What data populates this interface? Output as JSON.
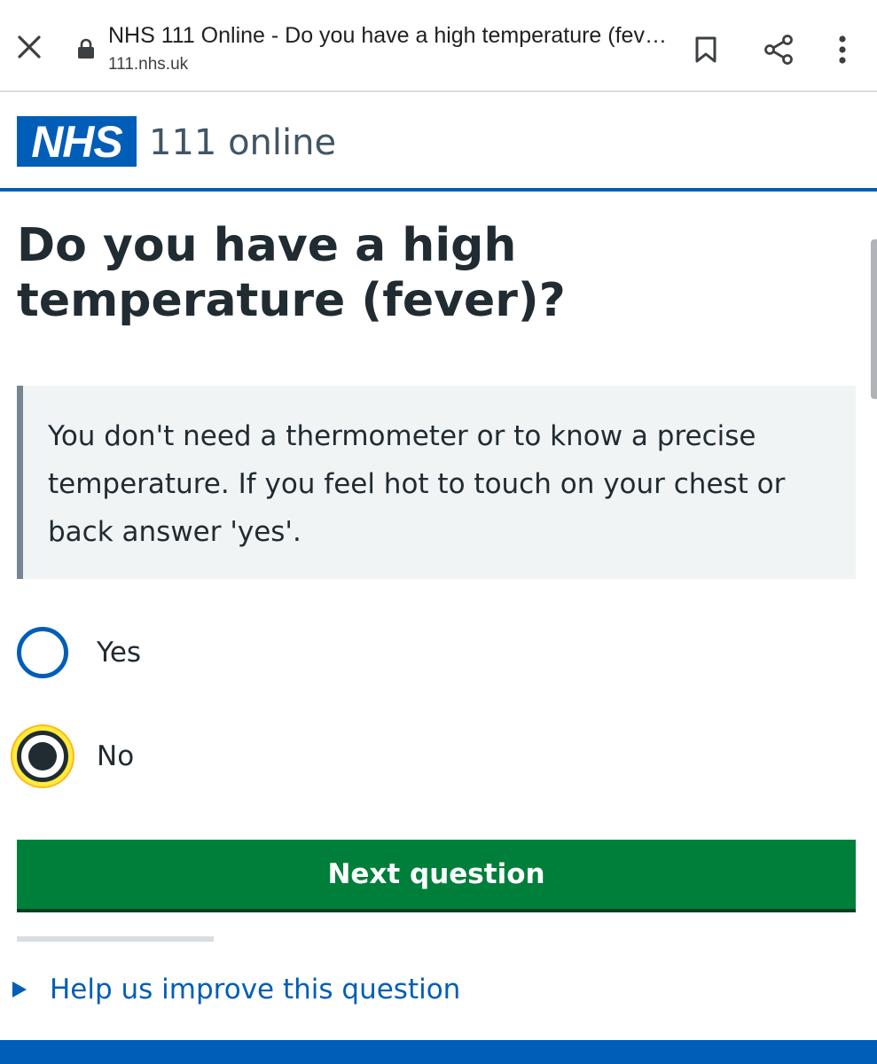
{
  "browser": {
    "title": "NHS 111 Online - Do you have a high temperature (fever)?",
    "url": "111.nhs.uk"
  },
  "header": {
    "logo_text": "NHS",
    "service_name": "111 online",
    "colors": {
      "nhs_blue": "#005eb8"
    }
  },
  "question": {
    "title": "Do you have a high temperature (fever)?",
    "hint": "You don't need a thermometer or to know a precise temperature. If you feel hot to touch on your chest or back answer 'yes'."
  },
  "options": [
    {
      "label": "Yes",
      "checked": false
    },
    {
      "label": "No",
      "checked": true
    }
  ],
  "actions": {
    "next_label": "Next question",
    "help_label": "Help us improve this question"
  },
  "icons": {
    "close": "close-icon",
    "lock": "lock-icon",
    "bookmark": "bookmark-icon",
    "share": "share-icon",
    "more": "more-vertical-icon"
  },
  "colors": {
    "button_green": "#007f3b",
    "focus_yellow": "#ffeb3b"
  }
}
